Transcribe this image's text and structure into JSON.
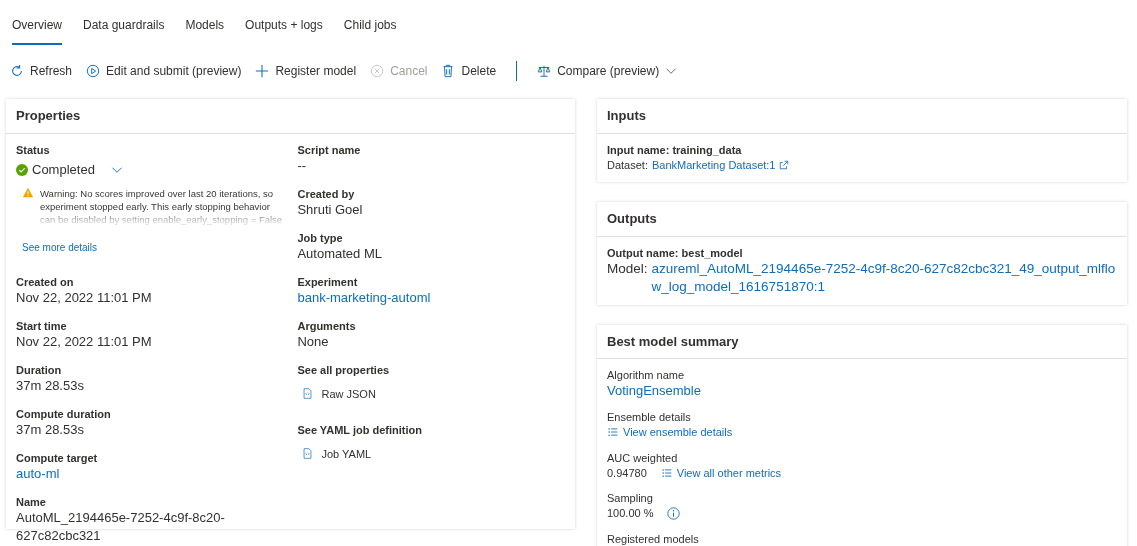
{
  "tabs": [
    {
      "label": "Overview",
      "selected": true
    },
    {
      "label": "Data guardrails",
      "selected": false
    },
    {
      "label": "Models",
      "selected": false
    },
    {
      "label": "Outputs + logs",
      "selected": false
    },
    {
      "label": "Child jobs",
      "selected": false
    }
  ],
  "toolbar": [
    {
      "kind": "refresh",
      "label": "Refresh",
      "disabled": false
    },
    {
      "kind": "play",
      "label": "Edit and submit (preview)",
      "disabled": false
    },
    {
      "kind": "plus",
      "label": "Register model",
      "disabled": false
    },
    {
      "kind": "cancel",
      "label": "Cancel",
      "disabled": true
    },
    {
      "kind": "delete",
      "label": "Delete",
      "disabled": false
    },
    {
      "kind": "compare",
      "label": "Compare (preview)",
      "disabled": false
    }
  ],
  "properties": {
    "title": "Properties",
    "left_fields": [
      {
        "kind": "status",
        "label": "Status",
        "value": "Completed",
        "warning": "Warning: No scores improved over last 20 iterations, so experiment stopped early. This early stopping behavior can be disabled by setting enable_early_stopping = False",
        "warning_link": "See more details"
      },
      {
        "kind": "text",
        "label": "Created on",
        "value": "Nov 22, 2022 11:01 PM"
      },
      {
        "kind": "text",
        "label": "Start time",
        "value": "Nov 22, 2022 11:01 PM"
      },
      {
        "kind": "text",
        "label": "Duration",
        "value": "37m 28.53s"
      },
      {
        "kind": "text",
        "label": "Compute duration",
        "value": "37m 28.53s"
      },
      {
        "kind": "link",
        "label": "Compute target",
        "value": "auto-ml"
      },
      {
        "kind": "text",
        "label": "Name",
        "value": "AutoML_2194465e-7252-4c9f-8c20-627c82cbc321"
      }
    ],
    "right_fields": [
      {
        "kind": "text",
        "label": "Script name",
        "value": "--"
      },
      {
        "kind": "text",
        "label": "Created by",
        "value": "Shruti Goel"
      },
      {
        "kind": "text",
        "label": "Job type",
        "value": "Automated ML"
      },
      {
        "kind": "link",
        "label": "Experiment",
        "value": "bank-marketing-automl"
      },
      {
        "kind": "text",
        "label": "Arguments",
        "value": "None"
      },
      {
        "kind": "file",
        "label": "See all properties",
        "value": "Raw JSON"
      },
      {
        "kind": "file",
        "label": "See YAML job definition",
        "value": "Job YAML"
      }
    ]
  },
  "inputs": {
    "title": "Inputs",
    "name": "Input name: training_data",
    "prefix": "Dataset:",
    "link": "BankMarketing Dataset:1"
  },
  "outputs": {
    "title": "Outputs",
    "name": "Output name: best_model",
    "prefix": "Model:",
    "link": "azureml_AutoML_2194465e-7252-4c9f-8c20-627c82cbc321_49_output_mlflow_log_model_1616751870:1"
  },
  "summary": {
    "title": "Best model summary",
    "fields": [
      {
        "kind": "biglink",
        "label": "Algorithm name",
        "value": "VotingEnsemble"
      },
      {
        "kind": "listlink",
        "label": "Ensemble details",
        "link": "View ensemble details"
      },
      {
        "kind": "valuelistlink",
        "label": "AUC weighted",
        "value": "0.94780",
        "link": "View all other metrics"
      },
      {
        "kind": "valueinfo",
        "label": "Sampling",
        "value": "100.00 %"
      },
      {
        "kind": "label",
        "label": "Registered models"
      }
    ]
  }
}
